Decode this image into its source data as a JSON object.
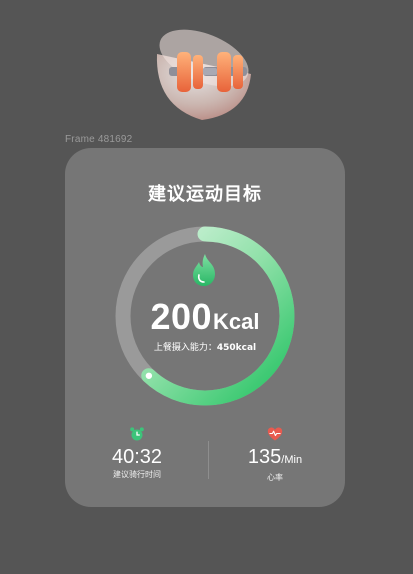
{
  "hero": {
    "icon": "dumbbell-in-bowl-icon"
  },
  "frame_label": "Frame 481692",
  "card": {
    "title": "建议运动目标",
    "calorie_value": "200",
    "calorie_unit": "Kcal",
    "intake_label": "上餐摄入能力：",
    "intake_value": "450kcal",
    "ring_icon": "flame-icon",
    "progress": 0.62
  },
  "stats": {
    "duration": {
      "icon": "alarm-clock-icon",
      "value": "40:32",
      "label": "建议骑行时间"
    },
    "heart_rate": {
      "icon": "heart-pulse-icon",
      "value": "135",
      "unit": "/Min",
      "label": "心率"
    }
  },
  "colors": {
    "background": "#555555",
    "card": "#767676",
    "ring_track": "#9a9a9a",
    "ring_green": "#2ecc71",
    "heart": "#e85a4f",
    "accent_orange": "#f08a4b"
  }
}
